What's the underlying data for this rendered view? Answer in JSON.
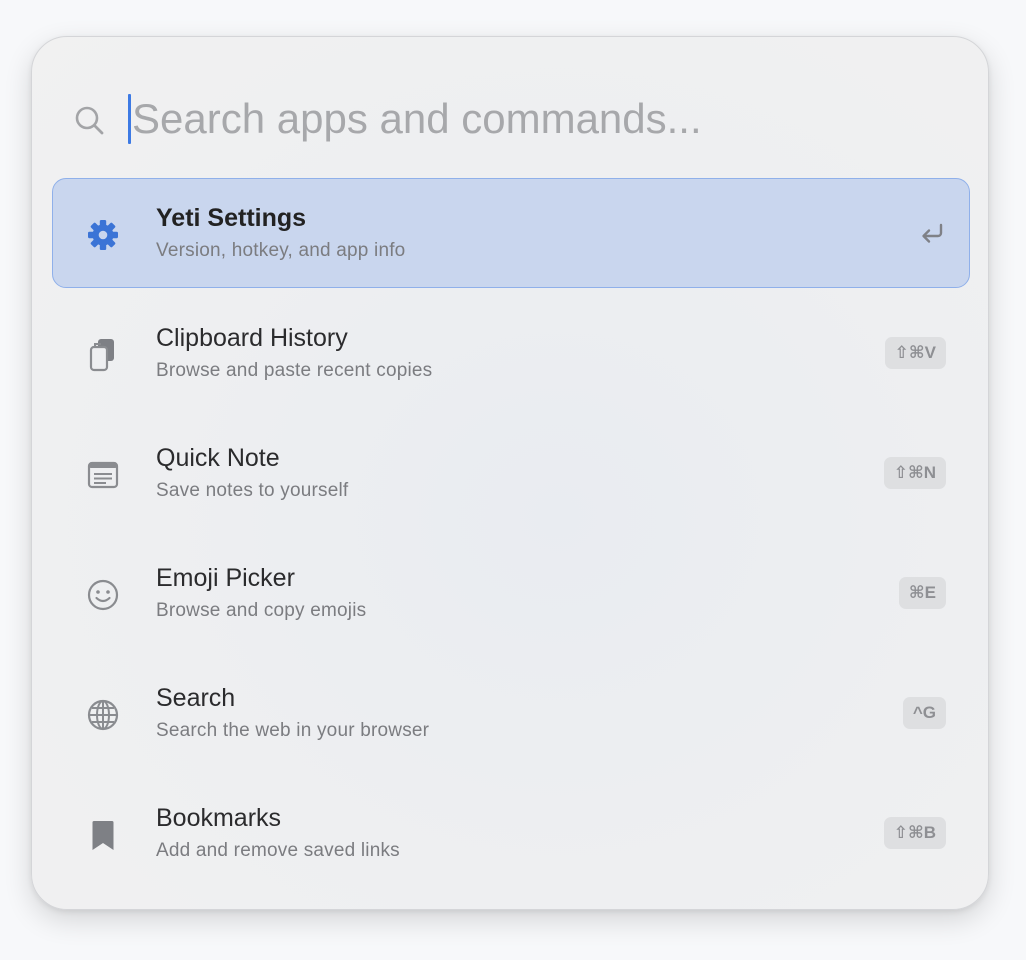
{
  "search": {
    "placeholder": "Search apps and commands...",
    "value": ""
  },
  "colors": {
    "accent": "#3d7ae4",
    "selected_background": "#c9d6ee",
    "selected_border": "#8fb0ea"
  },
  "items": [
    {
      "title": "Yeti Settings",
      "subtitle": "Version, hotkey, and app info",
      "icon": "gear-icon",
      "selected": true,
      "action_hint_icon": "return-icon"
    },
    {
      "title": "Clipboard History",
      "subtitle": "Browse and paste recent copies",
      "icon": "clipboard-icon",
      "shortcut": "⇧⌘V"
    },
    {
      "title": "Quick Note",
      "subtitle": "Save notes to yourself",
      "icon": "note-icon",
      "shortcut": "⇧⌘N"
    },
    {
      "title": "Emoji Picker",
      "subtitle": "Browse and copy emojis",
      "icon": "smiley-icon",
      "shortcut": "⌘E"
    },
    {
      "title": "Search",
      "subtitle": "Search the web in your browser",
      "icon": "globe-icon",
      "shortcut": "^G"
    },
    {
      "title": "Bookmarks",
      "subtitle": "Add and remove saved links",
      "icon": "bookmark-icon",
      "shortcut": "⇧⌘B"
    }
  ]
}
